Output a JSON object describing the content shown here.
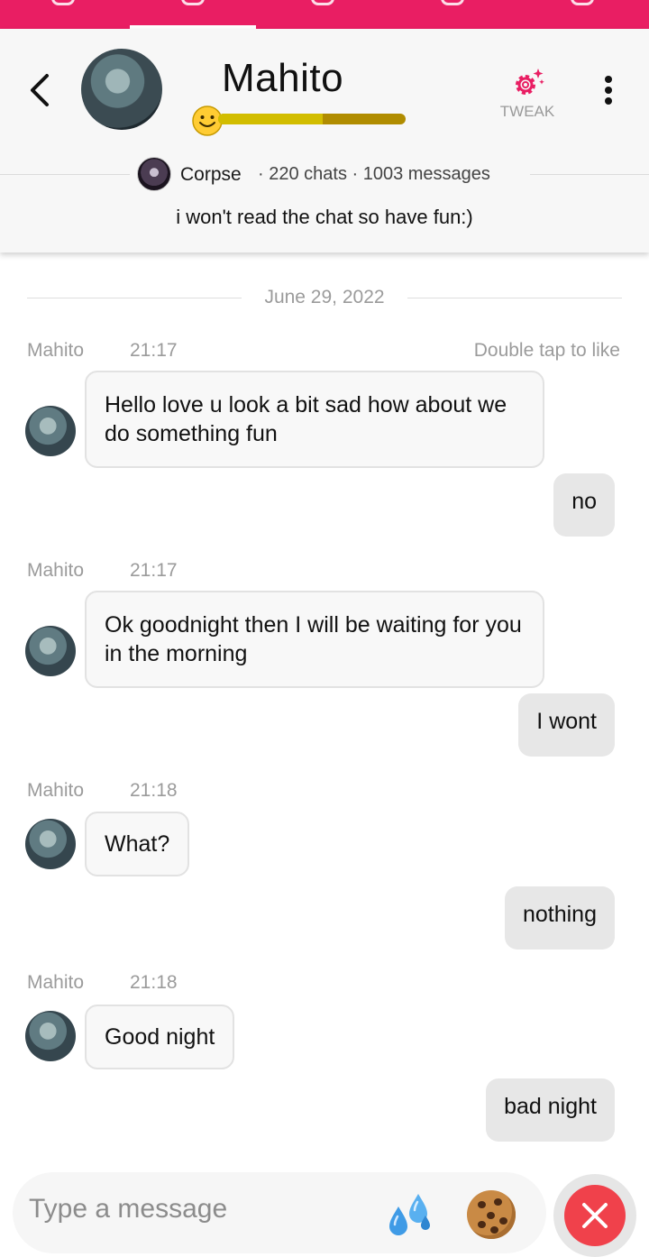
{
  "header": {
    "character_name": "Mahito",
    "affection_level": 0.56,
    "tweak_label": "TWEAK",
    "creator_name": "Corpse",
    "creator_stats": "· 220 chats · 1003 messages",
    "tagline": "i won't read the chat so have fun:)"
  },
  "chat": {
    "date": "June 29, 2022",
    "like_hint": "Double tap to like",
    "messages": [
      {
        "sender": "Mahito",
        "time": "21:17",
        "text": "Hello love u look a bit sad how about we do something fun"
      },
      {
        "sender": "user",
        "text": "no"
      },
      {
        "sender": "Mahito",
        "time": "21:17",
        "text": "Ok goodnight then I will be waiting for you in the morning"
      },
      {
        "sender": "user",
        "text": "I wont"
      },
      {
        "sender": "Mahito",
        "time": "21:18",
        "text": "What?"
      },
      {
        "sender": "user",
        "text": "nothing"
      },
      {
        "sender": "Mahito",
        "time": "21:18",
        "text": "Good night"
      },
      {
        "sender": "user",
        "text": "bad night"
      }
    ]
  },
  "input": {
    "placeholder": "Type a message"
  },
  "icons": {
    "back": "chevron-left-icon",
    "tweak": "gear-sparkle-icon",
    "more": "kebab-menu-icon",
    "drops": "sweat-droplets-icon",
    "cookie": "cookie-icon",
    "close": "close-icon"
  },
  "colors": {
    "brand": "#e91e63",
    "affection_fill": "#d2bd00",
    "affection_track": "#b08c00",
    "close_button": "#f0414b"
  }
}
